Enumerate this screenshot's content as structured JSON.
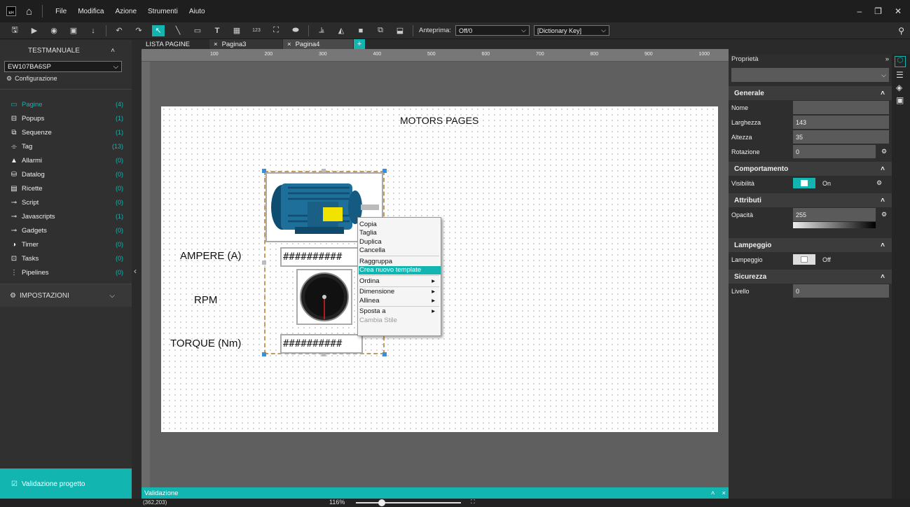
{
  "titlebar": {
    "logo": "kH",
    "menu": [
      "File",
      "Modifica",
      "Azione",
      "Strumenti",
      "Aiuto"
    ]
  },
  "toolbar": {
    "preview_label": "Anteprima:",
    "preview_value": "Off/0",
    "dict_value": "[Dictionary Key]",
    "num_icon_label": "123"
  },
  "sidebar": {
    "project": "TESTMANUALE",
    "device": "EW107BA6SP",
    "config": "Configurazione",
    "items": [
      {
        "label": "Pagine",
        "count": "(4)",
        "icon": "page-icon"
      },
      {
        "label": "Popups",
        "count": "(1)",
        "icon": "popup-icon"
      },
      {
        "label": "Sequenze",
        "count": "(1)",
        "icon": "sequence-icon"
      },
      {
        "label": "Tag",
        "count": "(13)",
        "icon": "tag-icon"
      },
      {
        "label": "Allarmi",
        "count": "(0)",
        "icon": "alarm-icon"
      },
      {
        "label": "Datalog",
        "count": "(0)",
        "icon": "datalog-icon"
      },
      {
        "label": "Ricette",
        "count": "(0)",
        "icon": "recipe-icon"
      },
      {
        "label": "Script",
        "count": "(0)",
        "icon": "script-icon"
      },
      {
        "label": "Javascripts",
        "count": "(1)",
        "icon": "javascript-icon"
      },
      {
        "label": "Gadgets",
        "count": "(0)",
        "icon": "gadget-icon"
      },
      {
        "label": "Timer",
        "count": "(0)",
        "icon": "timer-icon"
      },
      {
        "label": "Tasks",
        "count": "(0)",
        "icon": "tasks-icon"
      },
      {
        "label": "Pipelines",
        "count": "(0)",
        "icon": "pipelines-icon"
      }
    ],
    "settings": "IMPOSTAZIONI",
    "validate": "Validazione progetto"
  },
  "tabs": [
    "LISTA PAGINE",
    "Pagina3",
    "Pagina4"
  ],
  "ruler": [
    "100",
    "200",
    "300",
    "400",
    "500",
    "600",
    "700",
    "800",
    "900",
    "1000"
  ],
  "page": {
    "title": "MOTORS PAGES",
    "ampere": "AMPERE (A)",
    "rpm": "RPM",
    "torque": "TORQUE (Nm)",
    "hash1": "##########",
    "hash2": "##########"
  },
  "context_menu": {
    "items": [
      "Copia",
      "Taglia",
      "Duplica",
      "Cancella",
      "Raggruppa",
      "Crea nuovo template",
      "Ordina",
      "Dimensione",
      "Allinea",
      "Sposta a",
      "Cambia Stile"
    ]
  },
  "properties": {
    "header": "Proprietà",
    "general": "Generale",
    "nome": "Nome",
    "larghezza": "Larghezza",
    "larghezza_v": "143",
    "altezza": "Altezza",
    "altezza_v": "35",
    "rotazione": "Rotazione",
    "rotazione_v": "0",
    "comportamento": "Comportamento",
    "visibilita": "Visibilità",
    "visibilita_v": "On",
    "attributi": "Attributi",
    "opacita": "Opacità",
    "opacita_v": "255",
    "lampeggio_h": "Lampeggio",
    "lampeggio": "Lampeggio",
    "lampeggio_v": "Off",
    "sicurezza": "Sicurezza",
    "livello": "Livello",
    "livello_v": "0"
  },
  "validation_bar": "Validazione",
  "status": {
    "coords": "(362,203)",
    "zoom": "116%"
  }
}
